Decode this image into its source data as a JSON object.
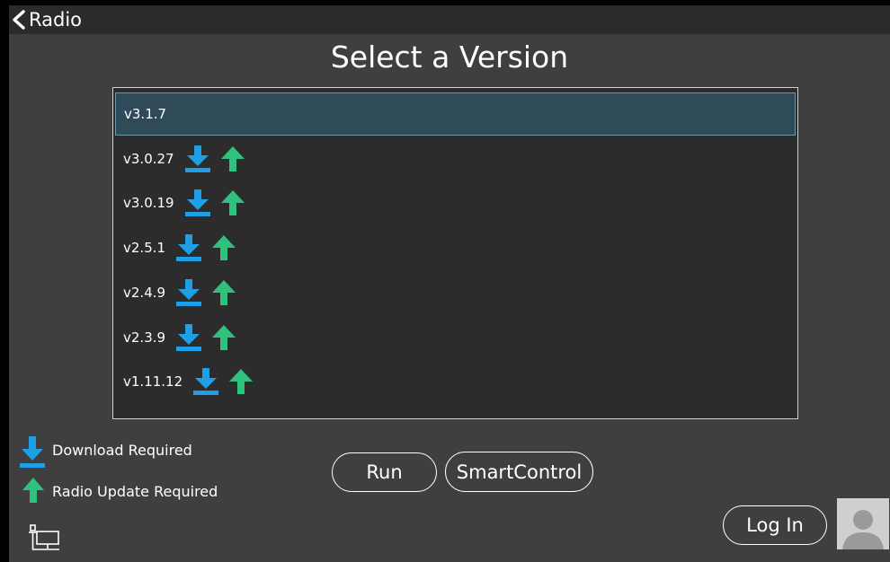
{
  "window": {
    "back_label": "Radio"
  },
  "page": {
    "title": "Select a Version"
  },
  "versions": [
    {
      "label": "v3.1.7",
      "selected": true,
      "download_required": false,
      "update_required": false
    },
    {
      "label": "v3.0.27",
      "selected": false,
      "download_required": true,
      "update_required": true
    },
    {
      "label": "v3.0.19",
      "selected": false,
      "download_required": true,
      "update_required": true
    },
    {
      "label": "v2.5.1",
      "selected": false,
      "download_required": true,
      "update_required": true
    },
    {
      "label": "v2.4.9",
      "selected": false,
      "download_required": true,
      "update_required": true
    },
    {
      "label": "v2.3.9",
      "selected": false,
      "download_required": true,
      "update_required": true
    },
    {
      "label": "v1.11.12",
      "selected": false,
      "download_required": true,
      "update_required": true
    }
  ],
  "legend": {
    "download_label": "Download Required",
    "update_label": "Radio Update Required"
  },
  "buttons": {
    "run_label": "Run",
    "smartcontrol_label": "SmartControl",
    "login_label": "Log In"
  },
  "icons": {
    "back": "chevron-left-icon",
    "download": "download-icon",
    "update": "arrow-up-icon",
    "network": "network-computer-icon",
    "avatar": "user-avatar-icon"
  },
  "colors": {
    "background": "#3f3f3f",
    "download_blue": "#1e9fe6",
    "update_green": "#2ec27e",
    "selected_row": "#2f4b5a"
  }
}
